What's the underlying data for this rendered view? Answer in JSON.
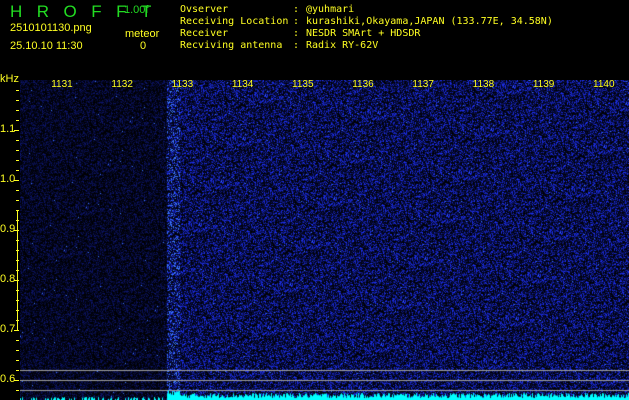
{
  "header": {
    "app_title": "HROFFT",
    "version": "1.00f",
    "filename": "2510101130.png",
    "datetime": "25.10.10 11:30",
    "meteor_label": "meteor",
    "meteor_count": "0"
  },
  "info": [
    {
      "label": "Ovserver",
      "value": "@yuhmari"
    },
    {
      "label": "Receiving Location",
      "value": "kurashiki,Okayama,JAPAN (133.77E, 34.58N)"
    },
    {
      "label": "Receiver",
      "value": "NESDR SMArt + HDSDR"
    },
    {
      "label": "Recviving antenna",
      "value": "Radix RY-62V"
    }
  ],
  "spectrogram": {
    "y_unit": "kHz",
    "x_labels": [
      "1131",
      "1132",
      "1133",
      "1134",
      "1135",
      "1136",
      "1137",
      "1138",
      "1139",
      "1140"
    ],
    "y_labels": [
      "1.1",
      "1.0",
      "0.9",
      "0.8",
      "0.7",
      "0.6"
    ],
    "colors": {
      "noise": "#2030ff",
      "signal_bar": "#00ffff",
      "ref_lines": "#a0a0a0",
      "labels": "#ffff22"
    }
  }
}
